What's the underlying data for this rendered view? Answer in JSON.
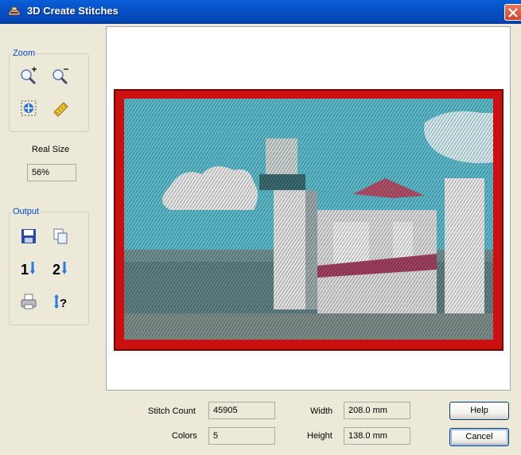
{
  "window": {
    "title": "3D Create Stitches"
  },
  "zoom": {
    "group_label": "Zoom",
    "real_size_label": "Real Size",
    "zoom_value": "56%",
    "buttons": [
      "zoom-in-icon",
      "zoom-out-icon",
      "fit-to-window-icon",
      "ruler-icon"
    ]
  },
  "output": {
    "group_label": "Output",
    "buttons": [
      "save-icon",
      "copy-icon",
      "one-step-icon",
      "two-step-icon",
      "print-icon",
      "info-icon"
    ]
  },
  "preview": {
    "description_colors": {
      "frame": "#cc1111",
      "sky": "#5ab8c8",
      "cloud": "#e6e6e6",
      "building": "#d8d8d8",
      "roof": "#b05068",
      "ground": "#6a8a8c"
    }
  },
  "stats": {
    "stitch_count_label": "Stitch Count",
    "stitch_count_value": "45905",
    "colors_label": "Colors",
    "colors_value": "5",
    "width_label": "Width",
    "width_value": "208.0 mm",
    "height_label": "Height",
    "height_value": "138.0 mm"
  },
  "buttons": {
    "help": "Help",
    "cancel": "Cancel"
  }
}
